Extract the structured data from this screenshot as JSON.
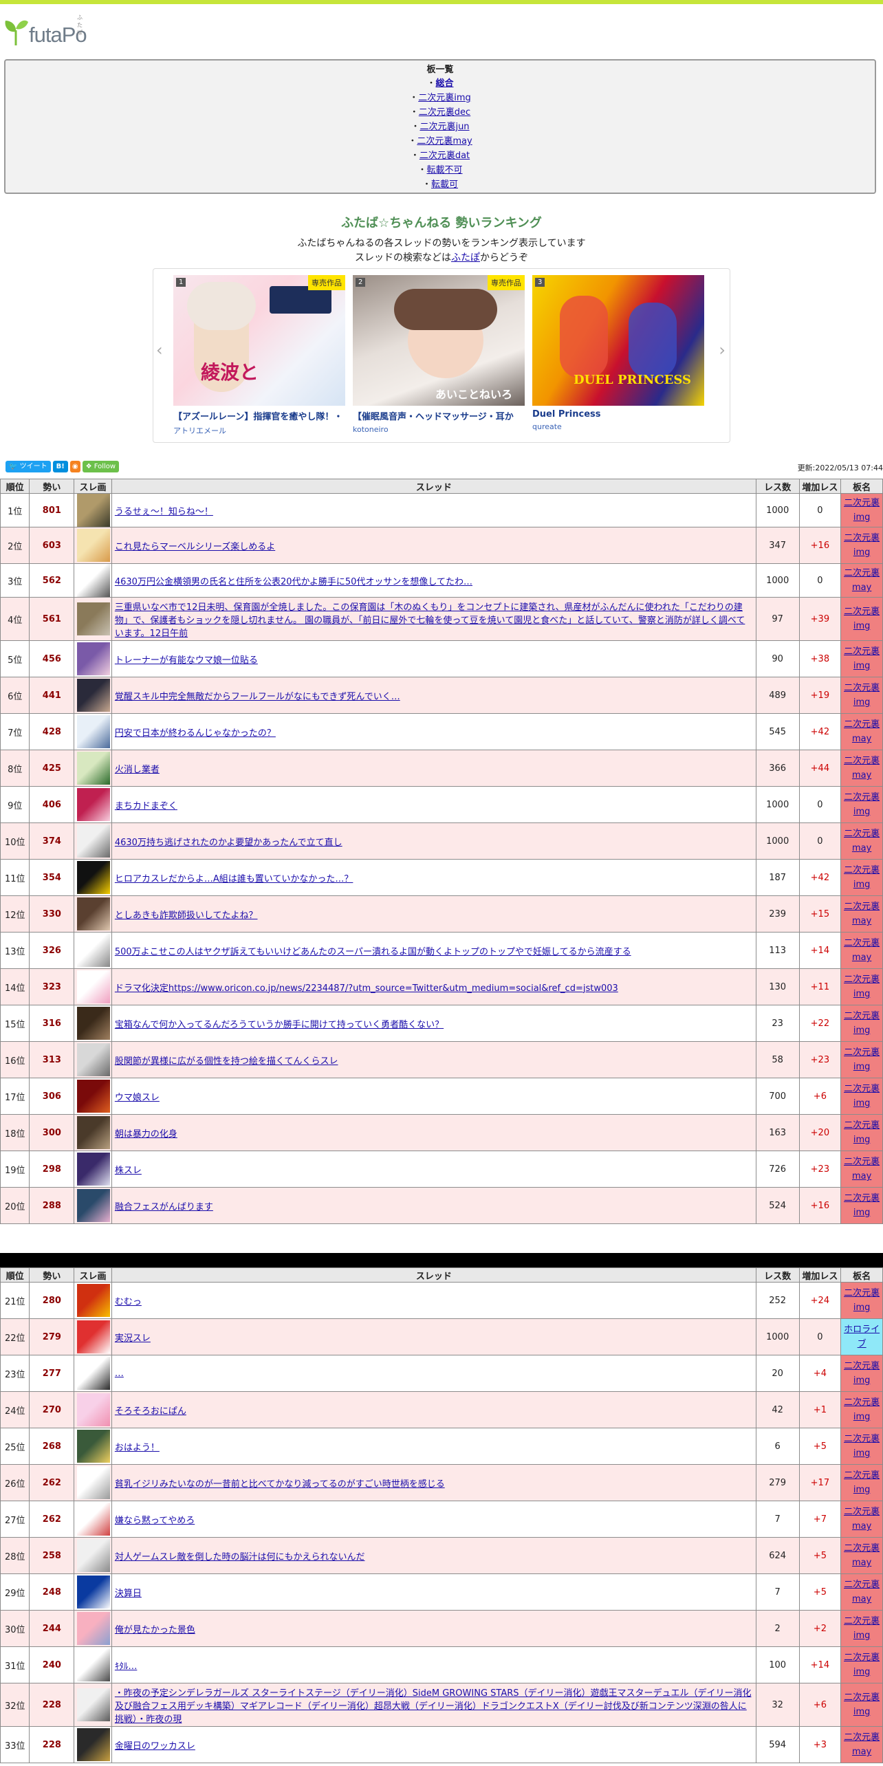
{
  "logo": {
    "text": "futaPo",
    "small": "ふたぽ"
  },
  "board_list": {
    "title": "板一覧",
    "items": [
      {
        "label": "総合",
        "bold": true
      },
      {
        "label": "二次元裏img"
      },
      {
        "label": "二次元裏dec"
      },
      {
        "label": "二次元裏jun"
      },
      {
        "label": "二次元裏may"
      },
      {
        "label": "二次元裏dat"
      },
      {
        "label": "転載不可"
      },
      {
        "label": "転載可"
      }
    ]
  },
  "ranking": {
    "title": "ふたば☆ちゃんねる 勢いランキング",
    "desc1": "ふたばちゃんねるの各スレッドの勢いをランキング表示しています",
    "desc2_pre": "スレッドの検索などは",
    "desc2_link": "ふたぽ",
    "desc2_post": "からどうぞ"
  },
  "carousel": {
    "cards": [
      {
        "num": "1",
        "tag": "専売作品",
        "title": "【アズールレーン】指揮官を癒やし隊！・",
        "sub": "アトリエメール",
        "img_text": "綾波と"
      },
      {
        "num": "2",
        "tag": "専売作品",
        "title": "【催眠風音声・ヘッドマッサージ・耳か",
        "sub": "kotoneiro",
        "img_text": "あいことねいろ"
      },
      {
        "num": "3",
        "tag": "",
        "title": "Duel Princess",
        "sub": "qureate",
        "img_text": "DUEL PRINCESS"
      }
    ]
  },
  "share": {
    "tweet": "ツイート",
    "hatena": "B!",
    "follow": "Follow"
  },
  "updated": "更新:2022/05/13 07:44",
  "table_headers": [
    "順位",
    "勢い",
    "スレ画",
    "スレッド",
    "レス数",
    "増加レス",
    "板名"
  ],
  "rows": [
    {
      "rank": "1位",
      "ikioi": "801",
      "thread": "うるせぇ～！知らね～！",
      "res": "1000",
      "inc": "0",
      "board": "二次元裏img",
      "lines": 1
    },
    {
      "rank": "2位",
      "ikioi": "603",
      "thread": "これ見たらマーベルシリーズ楽しめるよ",
      "res": "347",
      "inc": "+16",
      "board": "二次元裏img",
      "lines": 1
    },
    {
      "rank": "3位",
      "ikioi": "562",
      "thread": "4630万円公金横領男の氏名と住所を公表20代かよ勝手に50代オッサンを想像してたわ…",
      "res": "1000",
      "inc": "0",
      "board": "二次元裏may",
      "lines": 1
    },
    {
      "rank": "4位",
      "ikioi": "561",
      "thread": "三重県いなべ市で12日未明、保育園が全焼しました。この保育園は「木のぬくもり」をコンセプトに建築され、県産材がふんだんに使われた「こだわりの建物」で、保護者もショックを隠し切れません。 園の職員が、「前日に屋外で七輪を使って豆を焼いて園児と食べた」と話していて、警察と消防が詳しく調べています。12日午前",
      "res": "97",
      "inc": "+39",
      "board": "二次元裏img",
      "lines": 3
    },
    {
      "rank": "5位",
      "ikioi": "456",
      "thread": "トレーナーが有能なウマ娘一位貼る",
      "res": "90",
      "inc": "+38",
      "board": "二次元裏img",
      "lines": 1
    },
    {
      "rank": "6位",
      "ikioi": "441",
      "thread": "覚醒スキル中完全無敵だからフールフールがなにもできず死んでいく…",
      "res": "489",
      "inc": "+19",
      "board": "二次元裏img",
      "lines": 1
    },
    {
      "rank": "7位",
      "ikioi": "428",
      "thread": "円安で日本が終わるんじゃなかったの？",
      "res": "545",
      "inc": "+42",
      "board": "二次元裏may",
      "lines": 1
    },
    {
      "rank": "8位",
      "ikioi": "425",
      "thread": "火消し業者",
      "res": "366",
      "inc": "+44",
      "board": "二次元裏may",
      "lines": 1
    },
    {
      "rank": "9位",
      "ikioi": "406",
      "thread": "まちカドまぞく",
      "res": "1000",
      "inc": "0",
      "board": "二次元裏img",
      "lines": 1
    },
    {
      "rank": "10位",
      "ikioi": "374",
      "thread": "4630万持ち逃げされたのかよ要望かあったんで立て直し",
      "res": "1000",
      "inc": "0",
      "board": "二次元裏may",
      "lines": 1
    },
    {
      "rank": "11位",
      "ikioi": "354",
      "thread": "ヒロアカスレだからよ…A組は誰も置いていかなかった…？",
      "res": "187",
      "inc": "+42",
      "board": "二次元裏img",
      "lines": 1
    },
    {
      "rank": "12位",
      "ikioi": "330",
      "thread": "としあきも詐欺師扱いしてたよね？",
      "res": "239",
      "inc": "+15",
      "board": "二次元裏may",
      "lines": 1
    },
    {
      "rank": "13位",
      "ikioi": "326",
      "thread": "500万よこせこの人はヤクザ訴えてもいいけどあんたのスーパー潰れるよ国が動くよトップのトップやで妊娠してるから流産する",
      "res": "113",
      "inc": "+14",
      "board": "二次元裏may",
      "lines": 1
    },
    {
      "rank": "14位",
      "ikioi": "323",
      "thread": "ドラマ化決定https://www.oricon.co.jp/news/2234487/?utm_source=Twitter&utm_medium=social&ref_cd=jstw003",
      "res": "130",
      "inc": "+11",
      "board": "二次元裏img",
      "lines": 1
    },
    {
      "rank": "15位",
      "ikioi": "316",
      "thread": "宝箱なんで何か入ってるんだろうていうか勝手に開けて持っていく勇者酷くない？",
      "res": "23",
      "inc": "+22",
      "board": "二次元裏img",
      "lines": 1
    },
    {
      "rank": "16位",
      "ikioi": "313",
      "thread": "股関節が異様に広がる個性を持つ絵を描くてんくらスレ",
      "res": "58",
      "inc": "+23",
      "board": "二次元裏img",
      "lines": 1
    },
    {
      "rank": "17位",
      "ikioi": "306",
      "thread": "ウマ娘スレ",
      "res": "700",
      "inc": "+6",
      "board": "二次元裏img",
      "lines": 1
    },
    {
      "rank": "18位",
      "ikioi": "300",
      "thread": "朝は暴力の化身",
      "res": "163",
      "inc": "+20",
      "board": "二次元裏img",
      "lines": 1
    },
    {
      "rank": "19位",
      "ikioi": "298",
      "thread": "株スレ",
      "res": "726",
      "inc": "+23",
      "board": "二次元裏may",
      "lines": 1
    },
    {
      "rank": "20位",
      "ikioi": "288",
      "thread": "融合フェスがんばります",
      "res": "524",
      "inc": "+16",
      "board": "二次元裏img",
      "lines": 1
    }
  ],
  "rows2": [
    {
      "rank": "21位",
      "ikioi": "280",
      "thread": "むむっ",
      "res": "252",
      "inc": "+24",
      "board": "二次元裏img",
      "lines": 1
    },
    {
      "rank": "22位",
      "ikioi": "279",
      "thread": "実況スレ",
      "res": "1000",
      "inc": "0",
      "board": "ホロライブ",
      "lines": 1
    },
    {
      "rank": "23位",
      "ikioi": "277",
      "thread": "…",
      "res": "20",
      "inc": "+4",
      "board": "二次元裏img",
      "lines": 1
    },
    {
      "rank": "24位",
      "ikioi": "270",
      "thread": "そろそろおにぱん",
      "res": "42",
      "inc": "+1",
      "board": "二次元裏img",
      "lines": 1
    },
    {
      "rank": "25位",
      "ikioi": "268",
      "thread": "おはよう！",
      "res": "6",
      "inc": "+5",
      "board": "二次元裏img",
      "lines": 1
    },
    {
      "rank": "26位",
      "ikioi": "262",
      "thread": "貧乳イジリみたいなのが一昔前と比べてかなり減ってるのがすごい時世柄を感じる",
      "res": "279",
      "inc": "+17",
      "board": "二次元裏img",
      "lines": 1
    },
    {
      "rank": "27位",
      "ikioi": "262",
      "thread": "嫌なら黙ってやめろ",
      "res": "7",
      "inc": "+7",
      "board": "二次元裏may",
      "lines": 1
    },
    {
      "rank": "28位",
      "ikioi": "258",
      "thread": "対人ゲームスレ敵を倒した時の脳汁は何にもかえられないんだ",
      "res": "624",
      "inc": "+5",
      "board": "二次元裏may",
      "lines": 1
    },
    {
      "rank": "29位",
      "ikioi": "248",
      "thread": "決算日",
      "res": "7",
      "inc": "+5",
      "board": "二次元裏may",
      "lines": 1
    },
    {
      "rank": "30位",
      "ikioi": "244",
      "thread": "俺が見たかった景色",
      "res": "2",
      "inc": "+2",
      "board": "二次元裏img",
      "lines": 1
    },
    {
      "rank": "31位",
      "ikioi": "240",
      "thread": "ｷﾀﾙ…",
      "res": "100",
      "inc": "+14",
      "board": "二次元裏img",
      "lines": 1
    },
    {
      "rank": "32位",
      "ikioi": "228",
      "thread": "・昨夜の予定シンデレラガールズ スターライトステージ（デイリー消化）SideM GROWING STARS（デイリー消化）遊戯王マスターデュエル（デイリー消化及び融合フェス用デッキ構築）マギアレコード（デイリー消化）超昂大戦（デイリー消化）ドラゴンクエストX（デイリー討伐及び新コンテンツ深淵の咎人に挑戦）・昨夜の現",
      "res": "32",
      "inc": "+6",
      "board": "二次元裏img",
      "lines": 3
    },
    {
      "rank": "33位",
      "ikioi": "228",
      "thread": "金曜日のワッカスレ",
      "res": "594",
      "inc": "+3",
      "board": "二次元裏may",
      "lines": 1
    }
  ],
  "colors": {
    "topbar": "#c6e53a",
    "row_even": "#fde9e9",
    "board_bg": "#f08080",
    "holo_bg": "#8fe8f8",
    "ikioi": "#8b0000",
    "increase": "#cc0000"
  }
}
